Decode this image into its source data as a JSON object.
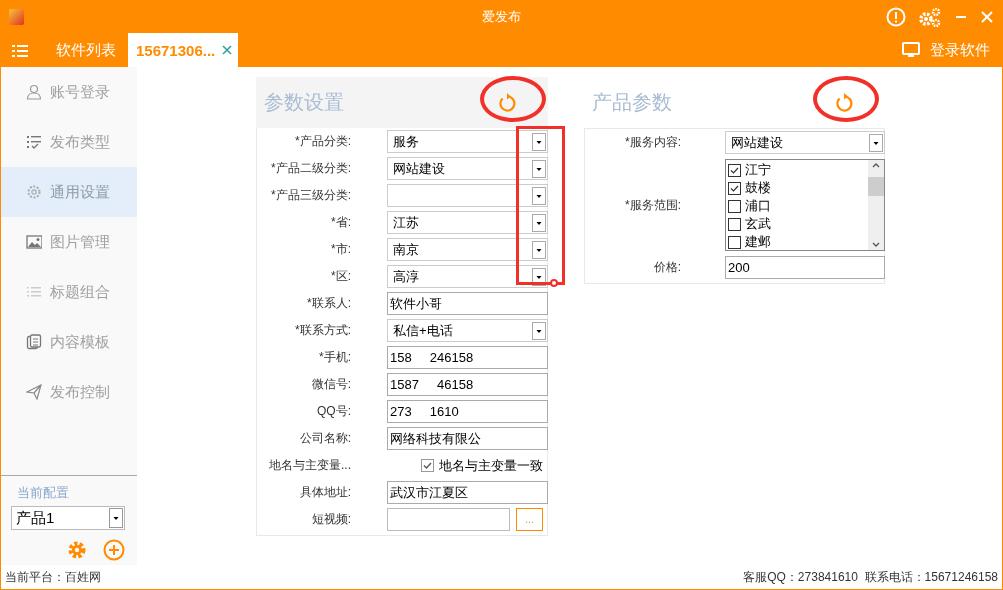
{
  "window": {
    "title": "爱发布"
  },
  "tabs": [
    {
      "label": "软件列表",
      "selected": false,
      "closable": false
    },
    {
      "label": "15671306...",
      "selected": true,
      "closable": true
    }
  ],
  "login_button": "登录软件",
  "sidebar": {
    "items": [
      {
        "label": "账号登录",
        "kind": "user",
        "selected": false
      },
      {
        "label": "发布类型",
        "kind": "checklist",
        "selected": false
      },
      {
        "label": "通用设置",
        "kind": "gear",
        "selected": true
      },
      {
        "label": "图片管理",
        "kind": "image",
        "selected": false
      },
      {
        "label": "标题组合",
        "kind": "list",
        "selected": false
      },
      {
        "label": "内容模板",
        "kind": "document",
        "selected": false
      },
      {
        "label": "发布控制",
        "kind": "send",
        "selected": false
      }
    ],
    "config_label": "当前配置",
    "config_value": "产品1"
  },
  "left_panel": {
    "title": "参数设置",
    "fields": [
      {
        "label": "*产品分类:",
        "kind": "select",
        "value": "服务"
      },
      {
        "label": "*产品二级分类:",
        "kind": "select",
        "value": "网站建设"
      },
      {
        "label": "*产品三级分类:",
        "kind": "select"
      },
      {
        "label": "*省:",
        "kind": "select",
        "value": "江苏"
      },
      {
        "label": "*市:",
        "kind": "select",
        "value": "南京"
      },
      {
        "label": "*区:",
        "kind": "select",
        "value": "高淳"
      },
      {
        "label": "*联系人:",
        "kind": "text",
        "value": "软件小哥"
      },
      {
        "label": "*联系方式:",
        "kind": "select",
        "value": "私信+电话"
      },
      {
        "label": "*手机:",
        "kind": "text",
        "value": "158     246158"
      },
      {
        "label": "微信号:",
        "kind": "text",
        "value": "1587     46158"
      },
      {
        "label": "QQ号:",
        "kind": "text",
        "value": "273     1610"
      },
      {
        "label": "公司名称:",
        "kind": "text",
        "value": "网络科技有限公"
      },
      {
        "label": "地名与主变量...",
        "kind": "checkbox",
        "text": "地名与主变量一致",
        "checked": true
      },
      {
        "label": "具体地址:",
        "kind": "text",
        "value": "武汉市江夏区"
      },
      {
        "label": "短视频:",
        "kind": "file",
        "button": "..."
      }
    ]
  },
  "right_panel": {
    "title": "产品参数",
    "fields": [
      {
        "label": "*服务内容:",
        "kind": "select",
        "value": "网站建设"
      },
      {
        "label": "*服务范围:",
        "kind": "checklist",
        "options": [
          {
            "label": "江宁",
            "checked": true
          },
          {
            "label": "鼓楼",
            "checked": true
          },
          {
            "label": "浦口",
            "checked": false
          },
          {
            "label": "玄武",
            "checked": false
          },
          {
            "label": "建邺",
            "checked": false
          }
        ]
      },
      {
        "label": "价格:",
        "kind": "text",
        "value": "200"
      }
    ]
  },
  "status_bar": {
    "platform": "当前平台：百姓网",
    "contact": "客服QQ：273841610  联系电话：15671246158"
  }
}
